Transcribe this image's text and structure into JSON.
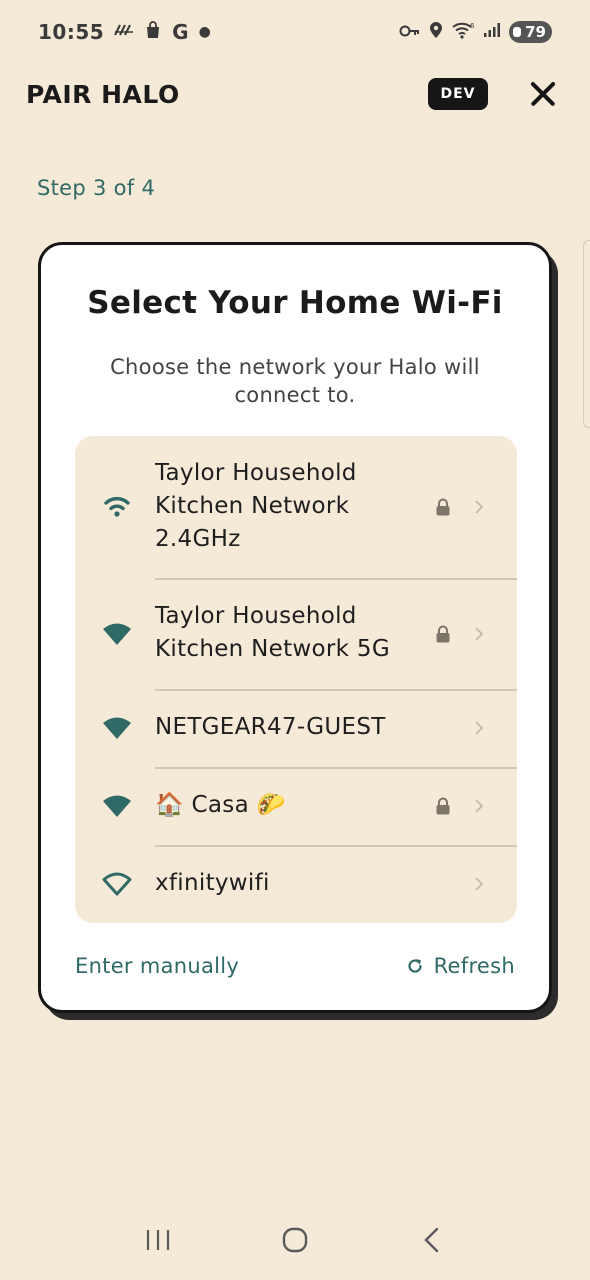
{
  "status_bar": {
    "time": "10:55",
    "left_icons": [
      "activity-icon",
      "shopping-bag-icon",
      "google-icon",
      "dot-icon"
    ],
    "google_glyph": "G",
    "right_icons": [
      "key-icon",
      "location-icon",
      "wifi-6-icon",
      "signal-icon"
    ],
    "battery": "79"
  },
  "header": {
    "title": "PAIR HALO",
    "badge": "DEV",
    "close_icon": "close-icon"
  },
  "step": "Step 3 of 4",
  "card": {
    "title": "Select Your Home Wi-Fi",
    "subtitle": "Choose the network your Halo will connect to.",
    "networks": [
      {
        "name": "Taylor Household Kitchen Network 2.4GHz",
        "secured": true,
        "signal_icon": "wifi-medium-icon"
      },
      {
        "name": "Taylor Household Kitchen Network 5G",
        "secured": true,
        "signal_icon": "wifi-full-icon"
      },
      {
        "name": "NETGEAR47-GUEST",
        "secured": false,
        "signal_icon": "wifi-full-icon"
      },
      {
        "name": "🏠 Casa 🌮",
        "secured": true,
        "signal_icon": "wifi-full-icon"
      },
      {
        "name": "xfinitywifi",
        "secured": false,
        "signal_icon": "wifi-outline-icon"
      }
    ],
    "enter_manually": "Enter manually",
    "refresh": "Refresh"
  },
  "nav_bar": {
    "icons": [
      "recents-icon",
      "home-icon",
      "back-icon"
    ]
  },
  "colors": {
    "background": "#f5e9d8",
    "accent_teal": "#2f6a66",
    "dark": "#161616"
  }
}
